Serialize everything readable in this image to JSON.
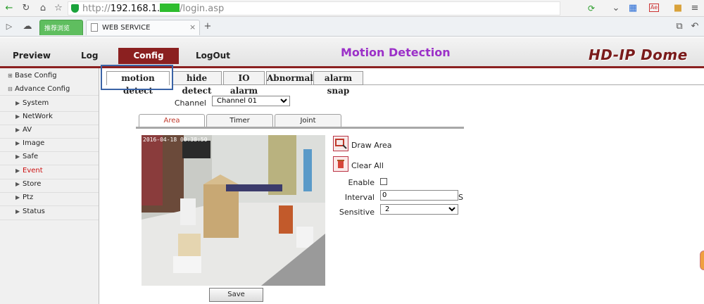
{
  "browser": {
    "url_prefix": "http://",
    "url_host": "192.168.1.",
    "url_path": "/login.asp",
    "tab_active_title": "WEB SERVICE",
    "tab_green_label": "推荐浏览",
    "new_tab_symbol": "+",
    "ext_badge": "Ae"
  },
  "app": {
    "nav": {
      "preview": "Preview",
      "log": "Log",
      "config": "Config",
      "logout": "LogOut"
    },
    "page_title": "Motion Detection",
    "brand": "HD-IP Dome",
    "accent": "#8b2020",
    "title_color": "#9b30c8"
  },
  "sidebar": {
    "base_config": "Base Config",
    "advance_config": "Advance Config",
    "items": [
      "System",
      "NetWork",
      "AV",
      "Image",
      "Safe",
      "Event",
      "Store",
      "Ptz",
      "Status"
    ],
    "active_item": "Event",
    "active_color": "#cc1111"
  },
  "tabs": [
    "motion detect",
    "hide detect",
    "IO alarm",
    "Abnormal",
    "alarm snap"
  ],
  "channel": {
    "label": "Channel",
    "value": "Channel 01"
  },
  "subtabs": [
    "Area",
    "Timer",
    "Joint"
  ],
  "camera": {
    "timestamp": "2016-04-18 00:38:50"
  },
  "actions": {
    "draw_area": "Draw Area",
    "clear_all": "Clear All"
  },
  "form": {
    "enable_label": "Enable",
    "interval_label": "Interval",
    "interval_value": "0",
    "interval_unit": "S",
    "sensitive_label": "Sensitive",
    "sensitive_value": "2"
  },
  "save_label": "Save",
  "icons": [
    "back-icon",
    "refresh-icon",
    "home-icon",
    "star-icon",
    "shield-icon",
    "cloud-icon",
    "close-icon",
    "undo-icon",
    "draw-area-icon",
    "trash-icon"
  ]
}
